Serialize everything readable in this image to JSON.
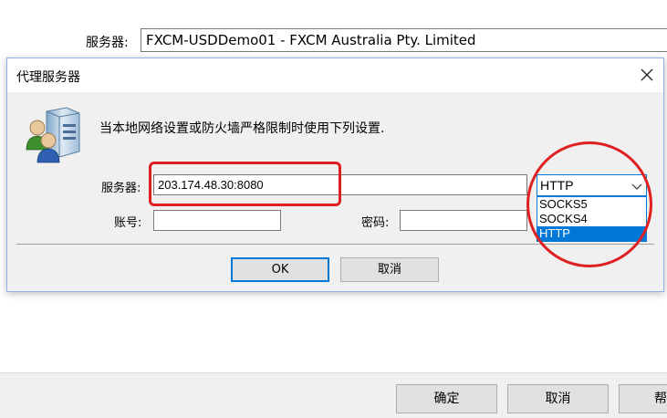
{
  "background_window": {
    "server_label": "服务器:",
    "server_value": "FXCM-USDDemo01 - FXCM Australia Pty. Limited",
    "buttons": {
      "confirm": "确定",
      "cancel": "取消",
      "help": "帮"
    }
  },
  "dialog": {
    "title": "代理服务器",
    "info_text": "当本地网络设置或防火墙严格限制时使用下列设置.",
    "server_label": "服务器:",
    "server_value": "203.174.48.30:8080",
    "account_label": "账号:",
    "account_value": "",
    "password_label": "密码:",
    "password_value": "",
    "proxy_type_selected": "HTTP",
    "proxy_type_options": [
      "SOCKS5",
      "SOCKS4",
      "HTTP"
    ],
    "ok_label": "OK",
    "cancel_label": "取消"
  },
  "icons": {
    "close": "close-icon",
    "server": "server-users-icon",
    "dropdown": "chevron-down-icon"
  },
  "colors": {
    "annotation": "#e02020",
    "selection": "#0078d7"
  }
}
